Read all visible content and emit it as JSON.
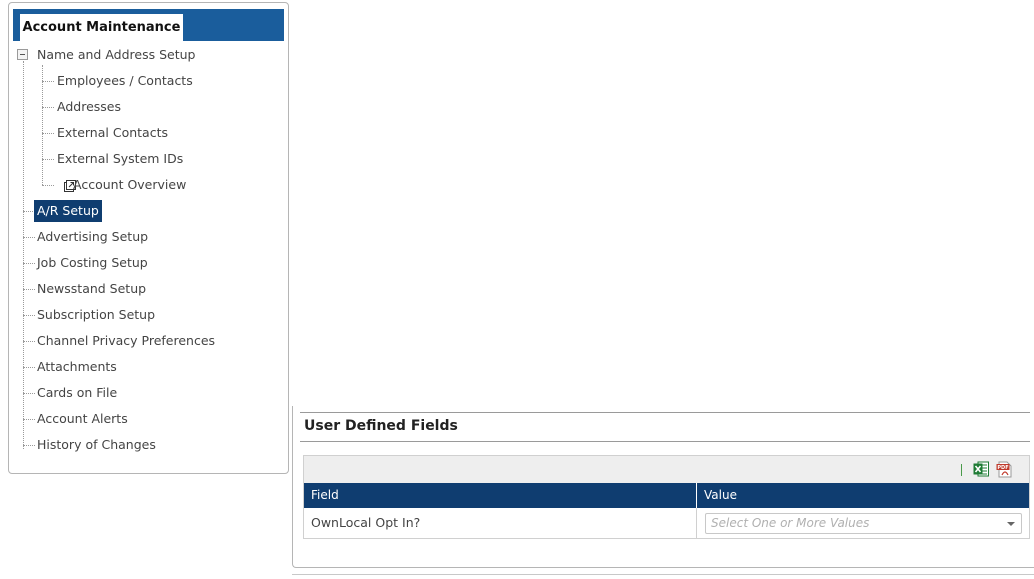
{
  "nav": {
    "header_tab": "Account Maintenance",
    "items": [
      {
        "label": "Name and Address Setup"
      },
      {
        "label": "Employees / Contacts"
      },
      {
        "label": "Addresses"
      },
      {
        "label": "External Contacts"
      },
      {
        "label": "External System IDs"
      },
      {
        "label": "Account Overview"
      },
      {
        "label": "A/R Setup",
        "selected": true
      },
      {
        "label": "Advertising Setup"
      },
      {
        "label": "Job Costing Setup"
      },
      {
        "label": "Newsstand Setup"
      },
      {
        "label": "Subscription Setup"
      },
      {
        "label": "Channel Privacy Preferences"
      },
      {
        "label": "Attachments"
      },
      {
        "label": "Cards on File"
      },
      {
        "label": "Account Alerts"
      },
      {
        "label": "History of Changes"
      }
    ]
  },
  "udf": {
    "title": "User Defined Fields",
    "columns": {
      "field": "Field",
      "value": "Value"
    },
    "rows": [
      {
        "field": "OwnLocal Opt In?",
        "value_placeholder": "Select One or More Values"
      }
    ],
    "toolbar": {
      "excel_icon": "excel-export-icon",
      "pdf_icon": "pdf-export-icon"
    }
  },
  "colors": {
    "header_blue": "#1a5d9c",
    "selected_navy": "#0f3d70",
    "excel_green": "#1e7b34",
    "pdf_red": "#c0392b"
  }
}
